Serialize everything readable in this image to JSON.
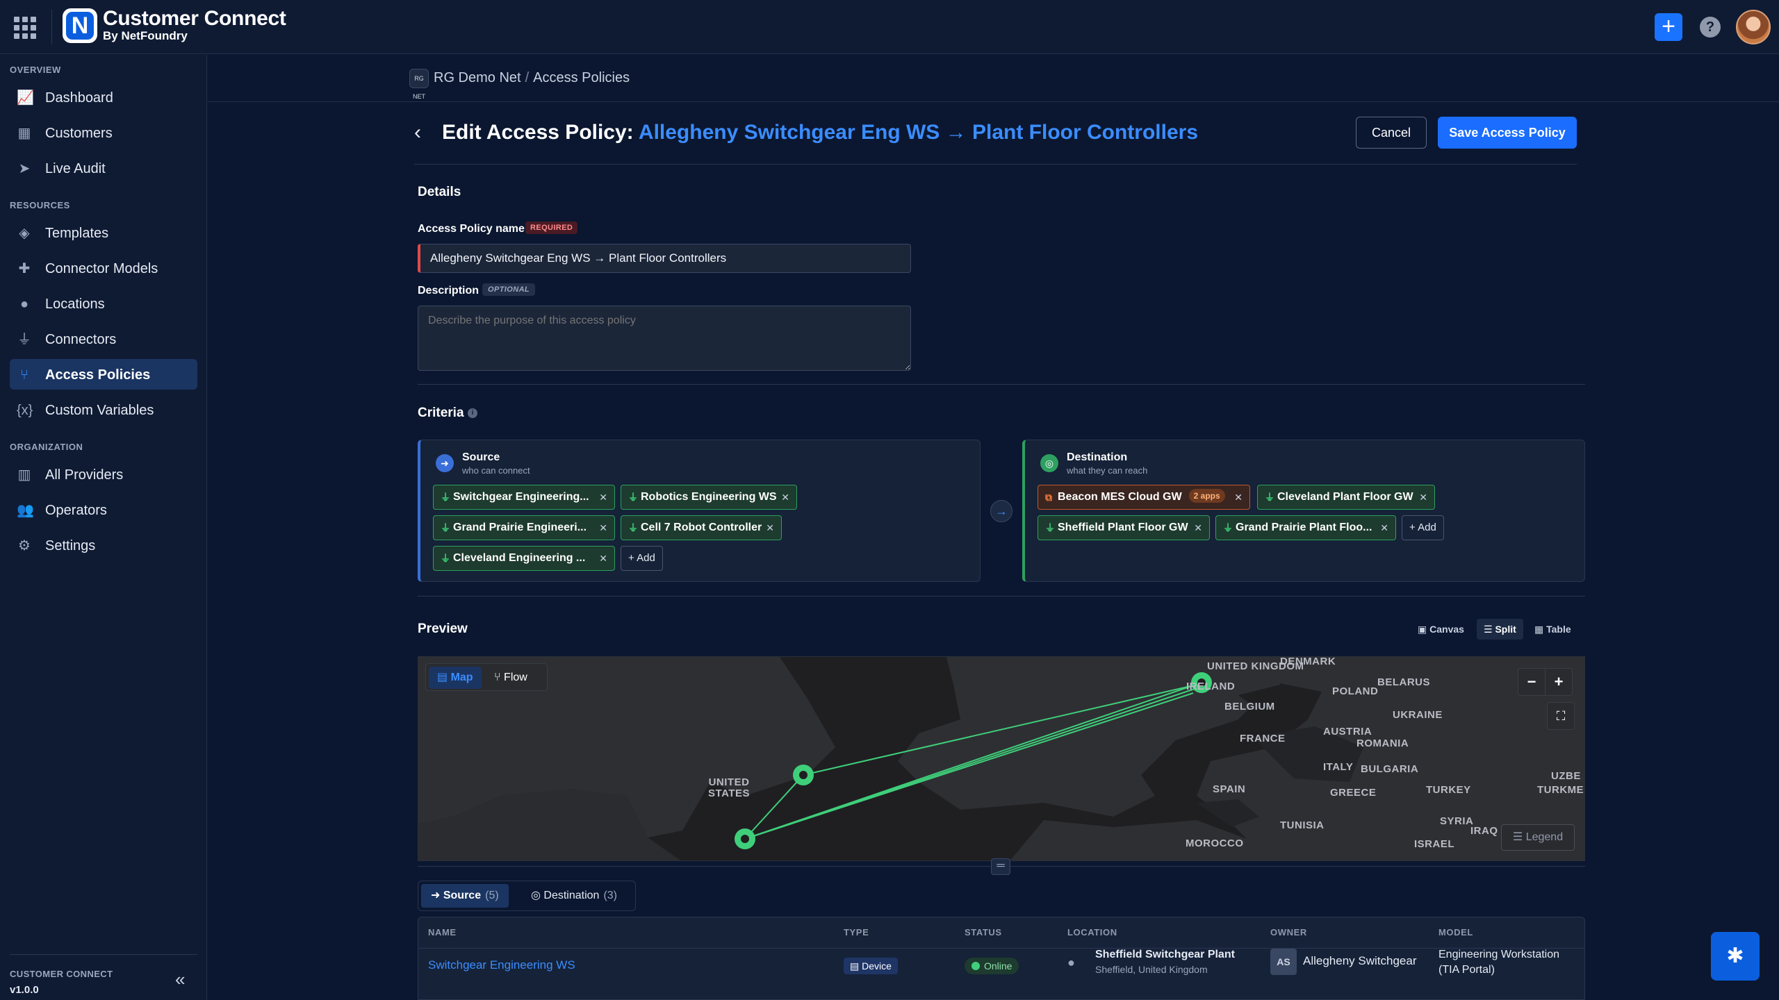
{
  "app": {
    "title": "Customer Connect",
    "subtitle": "By NetFoundry",
    "logo_letter": "N"
  },
  "topbar": {
    "add_icon": "plus-icon",
    "help_icon": "help-icon"
  },
  "sidebar": {
    "sections": [
      {
        "label": "OVERVIEW"
      },
      {
        "label": "RESOURCES"
      },
      {
        "label": "ORGANIZATION"
      }
    ],
    "items": [
      {
        "label": "Dashboard",
        "icon": "chart-line-icon"
      },
      {
        "label": "Customers",
        "icon": "building-icon"
      },
      {
        "label": "Live Audit",
        "icon": "send-icon"
      },
      {
        "label": "Templates",
        "icon": "layers-icon"
      },
      {
        "label": "Connector Models",
        "icon": "puzzle-icon"
      },
      {
        "label": "Locations",
        "icon": "map-pin-icon"
      },
      {
        "label": "Connectors",
        "icon": "plug-icon"
      },
      {
        "label": "Access Policies",
        "icon": "network-icon",
        "active": true
      },
      {
        "label": "Custom Variables",
        "icon": "variable-icon"
      },
      {
        "label": "All Providers",
        "icon": "providers-icon"
      },
      {
        "label": "Operators",
        "icon": "users-icon"
      },
      {
        "label": "Settings",
        "icon": "gears-icon"
      }
    ],
    "footer": {
      "name": "CUSTOMER CONNECT",
      "version": "v1.0.0"
    }
  },
  "breadcrumb": {
    "network_badge": "RG NET",
    "network": "RG Demo Net",
    "separator": "/",
    "page": "Access Policies"
  },
  "page": {
    "title_prefix": "Edit Access Policy:",
    "title_policy": "Allegheny Switchgear Eng WS → Plant Floor Controllers",
    "cancel_label": "Cancel",
    "save_label": "Save Access Policy"
  },
  "details": {
    "heading": "Details",
    "name_label": "Access Policy name",
    "name_required": "REQUIRED",
    "name_value": "Allegheny Switchgear Eng WS → Plant Floor Controllers",
    "description_label": "Description",
    "description_optional": "OPTIONAL",
    "description_placeholder": "Describe the purpose of this access policy"
  },
  "criteria": {
    "heading": "Criteria",
    "source": {
      "title": "Source",
      "subtitle": "who can connect",
      "chips": [
        "Switchgear Engineering...",
        "Robotics Engineering WS",
        "Grand Prairie Engineeri...",
        "Cell 7 Robot Controller",
        "Cleveland Engineering ..."
      ],
      "add_label": "+ Add"
    },
    "destination": {
      "title": "Destination",
      "subtitle": "what they can reach",
      "cloud_chip": {
        "label": "Beacon MES Cloud GW",
        "apps": "2 apps"
      },
      "chips": [
        "Cleveland Plant Floor GW",
        "Sheffield Plant Floor GW",
        "Grand Prairie Plant Floo..."
      ],
      "add_label": "+ Add"
    }
  },
  "preview": {
    "heading": "Preview",
    "views": [
      "Canvas",
      "Split",
      "Table"
    ],
    "active_view": "Split",
    "map_modes": [
      "Map",
      "Flow"
    ],
    "active_mode": "Map",
    "zoom_out": "−",
    "zoom_in": "+",
    "legend_label": "Legend",
    "map_labels": [
      "UNITED KINGDOM",
      "IRELAND",
      "DENMARK",
      "POLAND",
      "BELARUS",
      "BELGIUM",
      "UKRAINE",
      "FRANCE",
      "AUSTRIA",
      "ROMANIA",
      "ITALY",
      "BULGARIA",
      "SPAIN",
      "GREECE",
      "TURKEY",
      "TURKMENIS",
      "UZBE",
      "SYRIA",
      "IRAQ",
      "TUNISIA",
      "ISRAEL",
      "MOROCCO",
      "UNITED STATES"
    ]
  },
  "tabs": [
    {
      "label": "Source",
      "count": "(5)"
    },
    {
      "label": "Destination",
      "count": "(3)"
    }
  ],
  "table": {
    "columns": [
      "NAME",
      "TYPE",
      "STATUS",
      "LOCATION",
      "OWNER",
      "MODEL"
    ],
    "rows": [
      {
        "name": "Switchgear Engineering WS",
        "type": "Device",
        "status": "Online",
        "location": "Sheffield Switchgear Plant",
        "location_sub": "Sheffield, United Kingdom",
        "owner_initials": "AS",
        "owner": "Allegheny Switchgear",
        "model": "Engineering Workstation",
        "model_sub": "(TIA Portal)"
      }
    ]
  },
  "colors": {
    "accent": "#1a6dff",
    "source": "#3b6fd8",
    "destination": "#2ea060",
    "required": "#e04a4a"
  }
}
